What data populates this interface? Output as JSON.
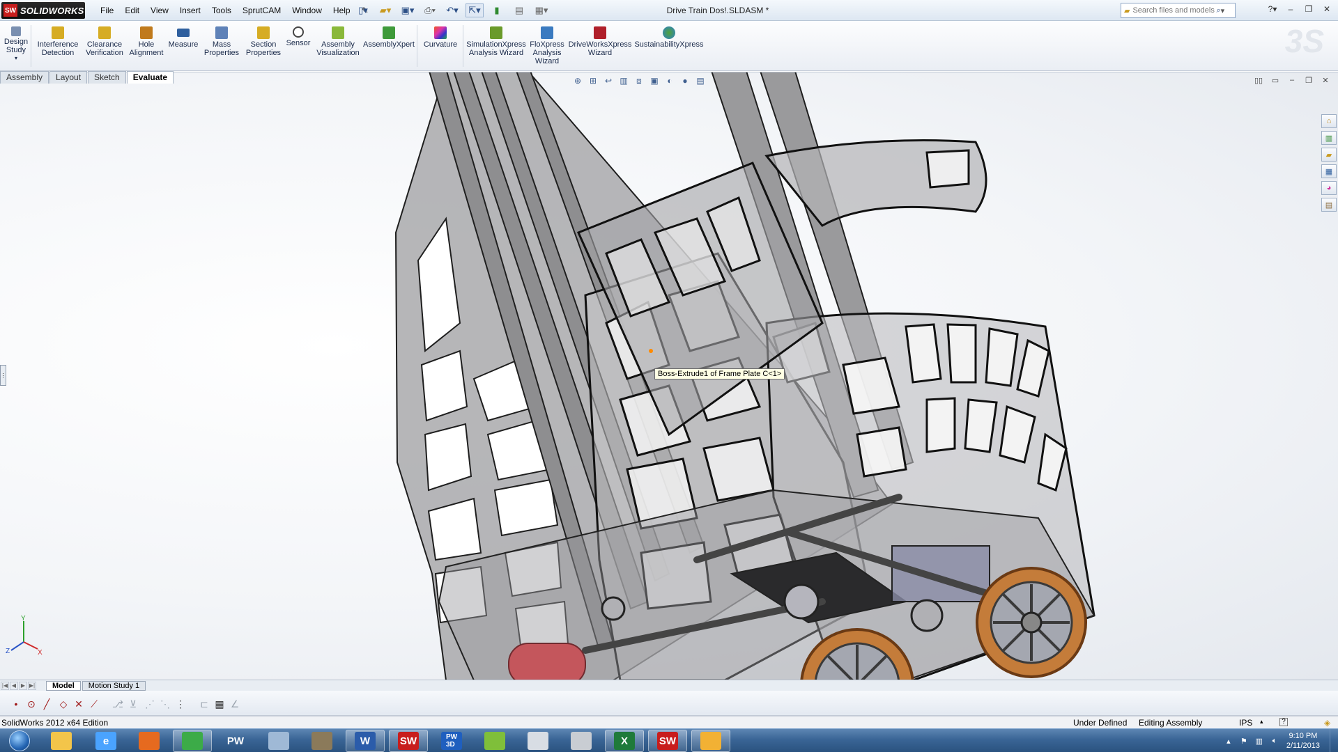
{
  "app": {
    "logo_text": "SOLIDWORKS",
    "logo_badge": "SW",
    "document_title": "Drive Train Dos!.SLDASM *",
    "menus": [
      "File",
      "Edit",
      "View",
      "Insert",
      "Tools",
      "SprutCAM",
      "Window",
      "Help"
    ],
    "search_placeholder": "Search files and models"
  },
  "ribbon": {
    "tools": [
      {
        "label": "Design\nStudy",
        "icon": "design-study-icon",
        "color": "#3b5d91"
      },
      {
        "label": "Interference\nDetection",
        "icon": "interference-icon",
        "color": "#c9a219"
      },
      {
        "label": "Clearance\nVerification",
        "icon": "clearance-icon",
        "color": "#c9a219"
      },
      {
        "label": "Hole\nAlignment",
        "icon": "hole-alignment-icon",
        "color": "#c07a1c"
      },
      {
        "label": "Measure",
        "icon": "measure-icon",
        "color": "#2f5f9e"
      },
      {
        "label": "Mass\nProperties",
        "icon": "mass-properties-icon",
        "color": "#2f5f9e"
      },
      {
        "label": "Section\nProperties",
        "icon": "section-properties-icon",
        "color": "#c9a219"
      },
      {
        "label": "Sensor",
        "icon": "sensor-icon",
        "color": "#444444"
      },
      {
        "label": "Assembly\nVisualization",
        "icon": "assembly-visualization-icon",
        "color": "#6a9a2a"
      },
      {
        "label": "AssemblyXpert",
        "icon": "assemblyxpert-icon",
        "color": "#3f9a3a"
      },
      {
        "label": "Curvature",
        "icon": "curvature-icon",
        "color": "#d0319c"
      },
      {
        "label": "SimulationXpress\nAnalysis Wizard",
        "icon": "simulationxpress-icon",
        "color": "#5b8f2a"
      },
      {
        "label": "FloXpress\nAnalysis\nWizard",
        "icon": "floxpress-icon",
        "color": "#3a7ac0"
      },
      {
        "label": "DriveWorksXpress\nWizard",
        "icon": "driveworksxpress-icon",
        "color": "#b01f2a"
      },
      {
        "label": "SustainabilityXpress",
        "icon": "sustainabilityxpress-icon",
        "color": "#4fa23a"
      }
    ]
  },
  "command_tabs": [
    "Assembly",
    "Layout",
    "Sketch",
    "Evaluate"
  ],
  "active_command_tab": "Evaluate",
  "viewport": {
    "tooltip": "Boss-Extrude1 of Frame Plate C<1>",
    "triad_labels": {
      "y": "Y",
      "z": "Z",
      "x": "X"
    }
  },
  "bottom_tabs": [
    "Model",
    "Motion Study 1"
  ],
  "active_bottom_tab": "Model",
  "status": {
    "edition": "SolidWorks 2012 x64 Edition",
    "state": "Under Defined",
    "mode": "Editing Assembly",
    "units": "IPS"
  },
  "taskbar": {
    "apps": [
      {
        "name": "explorer",
        "icon": "folder-icon",
        "label": "",
        "color": "#f3c54a"
      },
      {
        "name": "internet-explorer",
        "icon": "ie-icon",
        "label": "e",
        "color": "#4aa3ff"
      },
      {
        "name": "firefox",
        "icon": "firefox-icon",
        "label": "",
        "color": "#e66a1f"
      },
      {
        "name": "chrome",
        "icon": "chrome-icon",
        "label": "",
        "color": "#3cab48"
      },
      {
        "name": "pw",
        "icon": "pw-icon",
        "label": "PW",
        "color": "#ffffff"
      },
      {
        "name": "app-circle",
        "icon": "disc-icon",
        "label": "",
        "color": "#9fb9d6"
      },
      {
        "name": "gimp",
        "icon": "gimp-icon",
        "label": "",
        "color": "#8b7a5a"
      },
      {
        "name": "word",
        "icon": "word-icon",
        "label": "W",
        "color": "#2b5caa"
      },
      {
        "name": "solidworks-1",
        "icon": "solidworks-icon",
        "label": "SW",
        "color": "#c81d1d"
      },
      {
        "name": "pw3d",
        "icon": "pw3d-icon",
        "label": "PW\n3D",
        "color": "#1f5fbf"
      },
      {
        "name": "green-app",
        "icon": "leaf-icon",
        "label": "",
        "color": "#7fbf3a"
      },
      {
        "name": "calculator",
        "icon": "calculator-icon",
        "label": "",
        "color": "#d8dde4"
      },
      {
        "name": "tool-app",
        "icon": "pen-icon",
        "label": "",
        "color": "#c9cdd3"
      },
      {
        "name": "excel",
        "icon": "excel-icon",
        "label": "X",
        "color": "#1f7a3a"
      },
      {
        "name": "solidworks-2",
        "icon": "solidworks-icon",
        "label": "SW",
        "color": "#c81d1d"
      },
      {
        "name": "paint",
        "icon": "paint-icon",
        "label": "",
        "color": "#f2b134"
      }
    ],
    "clock_time": "9:10 PM",
    "clock_date": "2/11/2013"
  }
}
